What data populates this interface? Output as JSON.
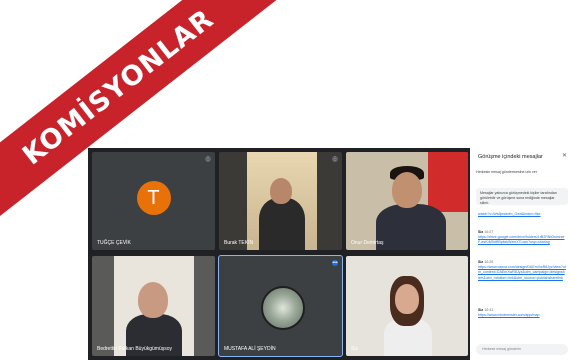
{
  "banner": {
    "text": "KOMİSYONLAR",
    "color": "#c8232b"
  },
  "tiles": [
    {
      "name": "TUĞÇE ÇEVİK",
      "avatar_letter": "T"
    },
    {
      "name": "Burak TEKİN"
    },
    {
      "name": "Onur Demirtaş"
    },
    {
      "name": "Bedrettin Furkan Büyükgümüşsoy"
    },
    {
      "name": "MUSTAFA ALİ ŞEYDİN"
    },
    {
      "name": "Siz"
    }
  ],
  "chat": {
    "title": "Görüşme içindeki mesajlar",
    "toggle_label": "Herkesin mesaj göndermesine izin ver",
    "info_text": "Mesajlar yalnızca görüşmedeki kişiler tarafından görülebilir ve görüşme sona erdiğinde mesajlar silinir.",
    "messages": [
      {
        "sender": "",
        "time": "",
        "text": "watch?v=Ws6jwzkdm_Gwd&index=Ilse"
      },
      {
        "sender": "Siz",
        "time": "10:27",
        "text": "https://drive.google.com/drive/folders/1rB2F8bDsmzzeF-esKrM9dHBpiwkWzmX7Lwm?usp=sharing"
      },
      {
        "sender": "Siz",
        "time": "10:29",
        "text": "https://www.canva.com/design/DAEmXwR8Jyz/view?utm_content=DAEmXwR8Jyz&utm_campaign=designshare&utm_medium=link&utm_source=publishsharelink"
      },
      {
        "sender": "Siz",
        "time": "10:31",
        "text": "https://www.mindmeister.com/app/map"
      }
    ],
    "input_placeholder": "Herkese mesaj gönderin"
  }
}
